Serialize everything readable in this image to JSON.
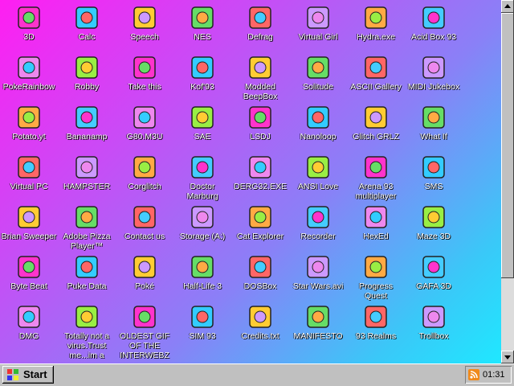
{
  "desktop": {
    "icons": [
      {
        "label": "3D",
        "icon": "teapot-icon"
      },
      {
        "label": "Calc",
        "icon": "calculator-icon"
      },
      {
        "label": "Speech",
        "icon": "face-speech-icon"
      },
      {
        "label": "NES",
        "icon": "nes-console-icon"
      },
      {
        "label": "Defrag",
        "icon": "defrag-icon"
      },
      {
        "label": "Virtual Girl",
        "icon": "girl-face-icon"
      },
      {
        "label": "Hydra.exe",
        "icon": "dragon-icon"
      },
      {
        "label": "Acid Box 93",
        "icon": "smiley-icon"
      },
      {
        "label": "PokeRainbow",
        "icon": "pokemon-trainers-icon"
      },
      {
        "label": "Robby",
        "icon": "stick-figure-icon"
      },
      {
        "label": "Take this",
        "icon": "ronald-icon"
      },
      {
        "label": "Kof'93",
        "icon": "fighter-face-icon"
      },
      {
        "label": "Modded BeepBox",
        "icon": "green-ring-icon"
      },
      {
        "label": "Solitude",
        "icon": "jar-icon"
      },
      {
        "label": "ASCII Gallery",
        "icon": "123-blocks-icon"
      },
      {
        "label": "MIDI Jukebox",
        "icon": "piano-keys-icon"
      },
      {
        "label": "Potato.yt",
        "icon": "potato-icon"
      },
      {
        "label": "Bananamp",
        "icon": "banana-icon"
      },
      {
        "label": "G80.M3U",
        "icon": "playlist-file-icon"
      },
      {
        "label": "SAE",
        "icon": "amiga-ball-icon"
      },
      {
        "label": "LSDJ",
        "icon": "lsdj-icon"
      },
      {
        "label": "Nanoloop",
        "icon": "wave-lines-icon"
      },
      {
        "label": "Glitch GRLZ",
        "icon": "lips-icon"
      },
      {
        "label": "What If",
        "icon": "book-grid-icon"
      },
      {
        "label": "Virtual PC",
        "icon": "window-pc-icon"
      },
      {
        "label": "HAMPSTER",
        "icon": "hamster-icon"
      },
      {
        "label": "Corglitch",
        "icon": "corgi-icon"
      },
      {
        "label": "Doctor Marburg",
        "icon": "doctor-icon"
      },
      {
        "label": "DERG32.EXE",
        "icon": "derg-monitor-icon"
      },
      {
        "label": "ANSI Love",
        "icon": "ansi-book-icon"
      },
      {
        "label": "Arena 93 multiplayer",
        "icon": "cube-icon"
      },
      {
        "label": "SMS",
        "icon": "sms-console-icon"
      },
      {
        "label": "Brian Sweeper",
        "icon": "mine-icon"
      },
      {
        "label": "Adobe Pizza Player™",
        "icon": "pizza-icon"
      },
      {
        "label": "Contact us",
        "icon": "contact-doc-icon"
      },
      {
        "label": "Storage (A:)",
        "icon": "floppy-drive-icon"
      },
      {
        "label": "Cat Explorer",
        "icon": "cat-globe-icon"
      },
      {
        "label": "Recorder",
        "icon": "microphone-icon"
      },
      {
        "label": "HexEd",
        "icon": "hexed-icon"
      },
      {
        "label": "Maze 3D",
        "icon": "maze-icon"
      },
      {
        "label": "Byte Beat",
        "icon": "bytebeat-icon"
      },
      {
        "label": "Puke Data",
        "icon": "pd-icon"
      },
      {
        "label": "Poké",
        "icon": "pokeball-icon"
      },
      {
        "label": "Half-Life 3",
        "icon": "lambda-icon"
      },
      {
        "label": "DOSBox",
        "icon": "dosbox-icon"
      },
      {
        "label": "Star Wars.avi",
        "icon": "yoda-icon"
      },
      {
        "label": "Progress Quest",
        "icon": "swords-icon"
      },
      {
        "label": "GAFA 3D",
        "icon": "doom-face-icon"
      },
      {
        "label": "DMG",
        "icon": "dmg-icon"
      },
      {
        "label": "Totally not a virus.Trust me...im a",
        "icon": "dolphin-icon"
      },
      {
        "label": "OLDEST GIF OF THE INTERWEBZ",
        "icon": "gif-icon"
      },
      {
        "label": "SIM 93",
        "icon": "open-book-icon"
      },
      {
        "label": "Credits.txt",
        "icon": "text-file-icon"
      },
      {
        "label": "MANIFESTO",
        "icon": "question-mark-icon"
      },
      {
        "label": "93 Realms",
        "icon": "realms-icon"
      },
      {
        "label": "Trollbox",
        "icon": "chat-smiley-icon"
      }
    ]
  },
  "taskbar": {
    "start_label": "Start",
    "clock": "01:31"
  },
  "colors": {
    "taskbar": "#c0c0c0",
    "label_text": "#ffffff",
    "desktop_gradient_start": "#ff1ef2",
    "desktop_gradient_end": "#1fe8ff"
  }
}
